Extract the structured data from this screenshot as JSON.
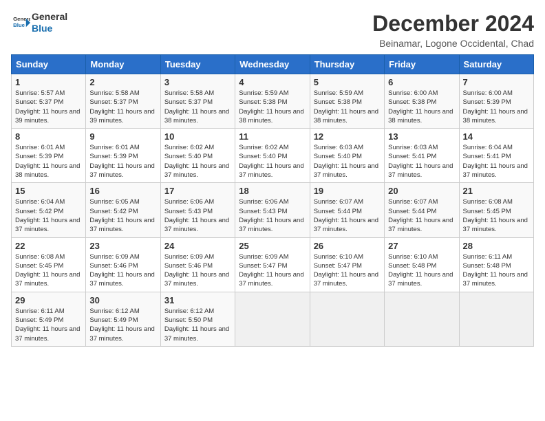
{
  "header": {
    "logo_line1": "General",
    "logo_line2": "Blue",
    "main_title": "December 2024",
    "subtitle": "Beinamar, Logone Occidental, Chad"
  },
  "calendar": {
    "weekdays": [
      "Sunday",
      "Monday",
      "Tuesday",
      "Wednesday",
      "Thursday",
      "Friday",
      "Saturday"
    ],
    "weeks": [
      [
        {
          "day": "1",
          "sunrise": "5:57 AM",
          "sunset": "5:37 PM",
          "daylight": "11 hours and 39 minutes."
        },
        {
          "day": "2",
          "sunrise": "5:58 AM",
          "sunset": "5:37 PM",
          "daylight": "11 hours and 39 minutes."
        },
        {
          "day": "3",
          "sunrise": "5:58 AM",
          "sunset": "5:37 PM",
          "daylight": "11 hours and 38 minutes."
        },
        {
          "day": "4",
          "sunrise": "5:59 AM",
          "sunset": "5:38 PM",
          "daylight": "11 hours and 38 minutes."
        },
        {
          "day": "5",
          "sunrise": "5:59 AM",
          "sunset": "5:38 PM",
          "daylight": "11 hours and 38 minutes."
        },
        {
          "day": "6",
          "sunrise": "6:00 AM",
          "sunset": "5:38 PM",
          "daylight": "11 hours and 38 minutes."
        },
        {
          "day": "7",
          "sunrise": "6:00 AM",
          "sunset": "5:39 PM",
          "daylight": "11 hours and 38 minutes."
        }
      ],
      [
        {
          "day": "8",
          "sunrise": "6:01 AM",
          "sunset": "5:39 PM",
          "daylight": "11 hours and 38 minutes."
        },
        {
          "day": "9",
          "sunrise": "6:01 AM",
          "sunset": "5:39 PM",
          "daylight": "11 hours and 37 minutes."
        },
        {
          "day": "10",
          "sunrise": "6:02 AM",
          "sunset": "5:40 PM",
          "daylight": "11 hours and 37 minutes."
        },
        {
          "day": "11",
          "sunrise": "6:02 AM",
          "sunset": "5:40 PM",
          "daylight": "11 hours and 37 minutes."
        },
        {
          "day": "12",
          "sunrise": "6:03 AM",
          "sunset": "5:40 PM",
          "daylight": "11 hours and 37 minutes."
        },
        {
          "day": "13",
          "sunrise": "6:03 AM",
          "sunset": "5:41 PM",
          "daylight": "11 hours and 37 minutes."
        },
        {
          "day": "14",
          "sunrise": "6:04 AM",
          "sunset": "5:41 PM",
          "daylight": "11 hours and 37 minutes."
        }
      ],
      [
        {
          "day": "15",
          "sunrise": "6:04 AM",
          "sunset": "5:42 PM",
          "daylight": "11 hours and 37 minutes."
        },
        {
          "day": "16",
          "sunrise": "6:05 AM",
          "sunset": "5:42 PM",
          "daylight": "11 hours and 37 minutes."
        },
        {
          "day": "17",
          "sunrise": "6:06 AM",
          "sunset": "5:43 PM",
          "daylight": "11 hours and 37 minutes."
        },
        {
          "day": "18",
          "sunrise": "6:06 AM",
          "sunset": "5:43 PM",
          "daylight": "11 hours and 37 minutes."
        },
        {
          "day": "19",
          "sunrise": "6:07 AM",
          "sunset": "5:44 PM",
          "daylight": "11 hours and 37 minutes."
        },
        {
          "day": "20",
          "sunrise": "6:07 AM",
          "sunset": "5:44 PM",
          "daylight": "11 hours and 37 minutes."
        },
        {
          "day": "21",
          "sunrise": "6:08 AM",
          "sunset": "5:45 PM",
          "daylight": "11 hours and 37 minutes."
        }
      ],
      [
        {
          "day": "22",
          "sunrise": "6:08 AM",
          "sunset": "5:45 PM",
          "daylight": "11 hours and 37 minutes."
        },
        {
          "day": "23",
          "sunrise": "6:09 AM",
          "sunset": "5:46 PM",
          "daylight": "11 hours and 37 minutes."
        },
        {
          "day": "24",
          "sunrise": "6:09 AM",
          "sunset": "5:46 PM",
          "daylight": "11 hours and 37 minutes."
        },
        {
          "day": "25",
          "sunrise": "6:09 AM",
          "sunset": "5:47 PM",
          "daylight": "11 hours and 37 minutes."
        },
        {
          "day": "26",
          "sunrise": "6:10 AM",
          "sunset": "5:47 PM",
          "daylight": "11 hours and 37 minutes."
        },
        {
          "day": "27",
          "sunrise": "6:10 AM",
          "sunset": "5:48 PM",
          "daylight": "11 hours and 37 minutes."
        },
        {
          "day": "28",
          "sunrise": "6:11 AM",
          "sunset": "5:48 PM",
          "daylight": "11 hours and 37 minutes."
        }
      ],
      [
        {
          "day": "29",
          "sunrise": "6:11 AM",
          "sunset": "5:49 PM",
          "daylight": "11 hours and 37 minutes."
        },
        {
          "day": "30",
          "sunrise": "6:12 AM",
          "sunset": "5:49 PM",
          "daylight": "11 hours and 37 minutes."
        },
        {
          "day": "31",
          "sunrise": "6:12 AM",
          "sunset": "5:50 PM",
          "daylight": "11 hours and 37 minutes."
        },
        null,
        null,
        null,
        null
      ]
    ]
  }
}
